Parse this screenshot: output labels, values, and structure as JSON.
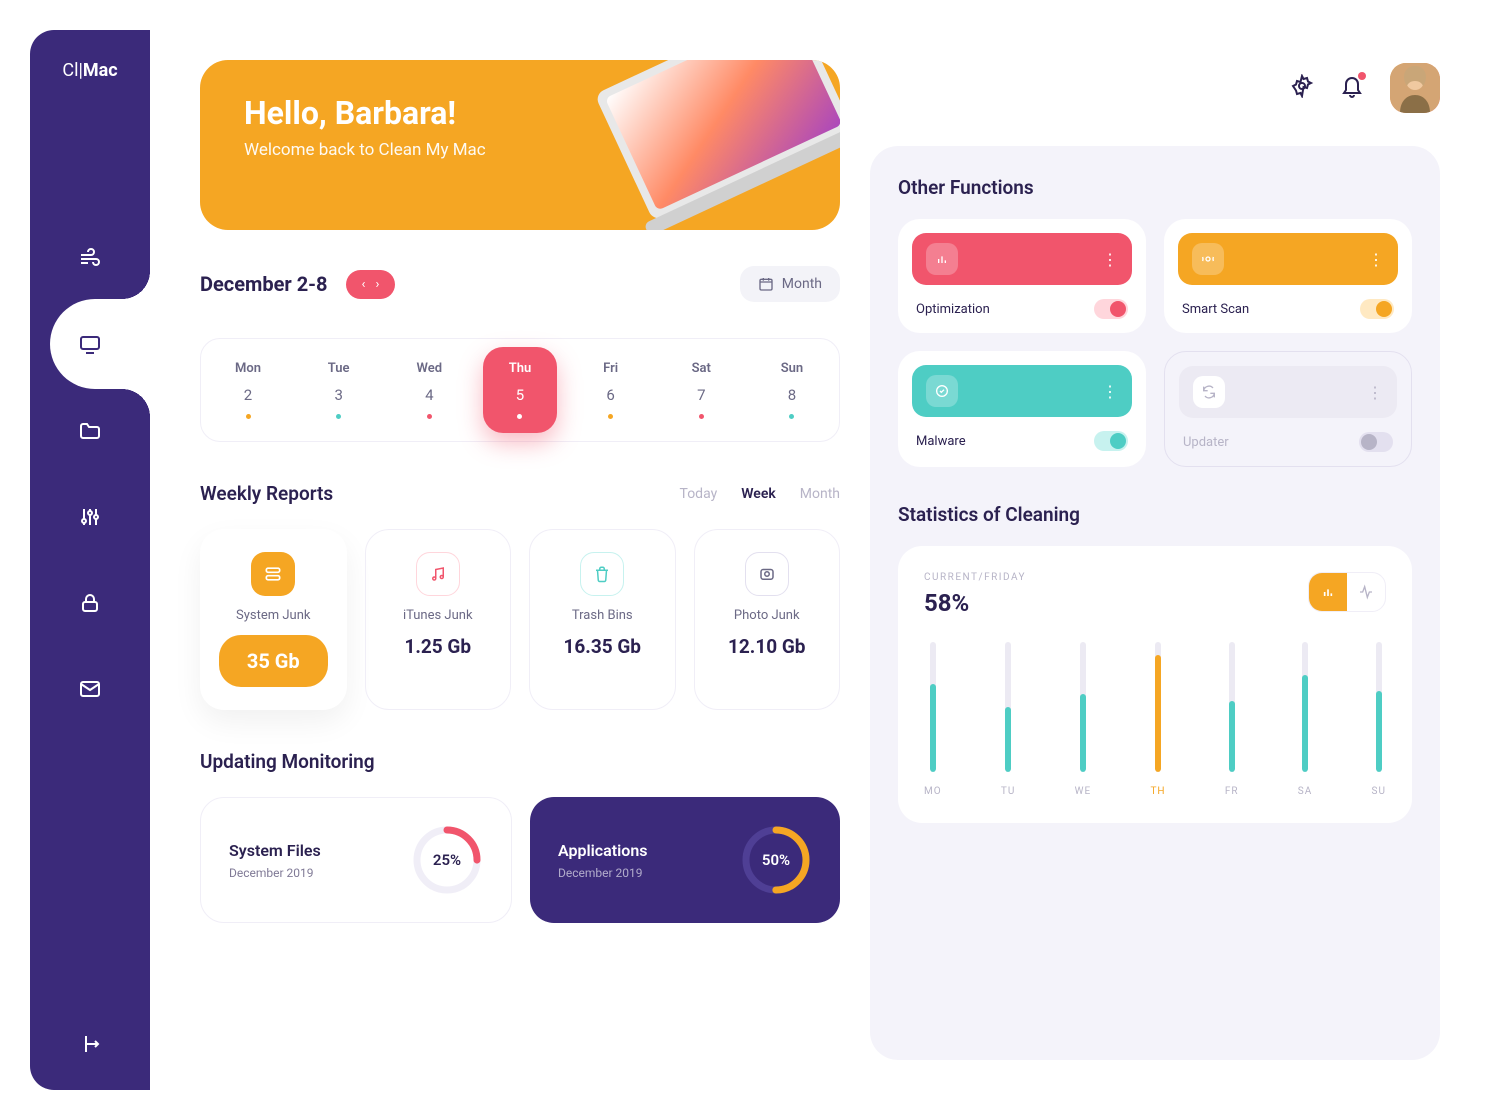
{
  "brand": {
    "prefix": "Cl",
    "name": "Mac"
  },
  "hero": {
    "greeting": "Hello, Barbara!",
    "subtitle": "Welcome back to Clean My Mac"
  },
  "date": {
    "range": "December 2-8",
    "view_label": "Month"
  },
  "days": [
    {
      "name": "Mon",
      "num": "2",
      "dot": "#f5a623"
    },
    {
      "name": "Tue",
      "num": "3",
      "dot": "#4ecdc4"
    },
    {
      "name": "Wed",
      "num": "4",
      "dot": "#f1556c"
    },
    {
      "name": "Thu",
      "num": "5",
      "dot": "#ffffff",
      "active": true
    },
    {
      "name": "Fri",
      "num": "6",
      "dot": "#f5a623"
    },
    {
      "name": "Sat",
      "num": "7",
      "dot": "#f1556c"
    },
    {
      "name": "Sun",
      "num": "8",
      "dot": "#4ecdc4"
    }
  ],
  "reports": {
    "title": "Weekly Reports",
    "tabs": {
      "today": "Today",
      "week": "Week",
      "month": "Month"
    },
    "cards": [
      {
        "name": "System Junk",
        "value": "35 Gb",
        "active": true
      },
      {
        "name": "iTunes Junk",
        "value": "1.25 Gb"
      },
      {
        "name": "Trash Bins",
        "value": "16.35 Gb"
      },
      {
        "name": "Photo Junk",
        "value": "12.10 Gb"
      }
    ]
  },
  "monitoring": {
    "title": "Updating Monitoring",
    "items": [
      {
        "title": "System Files",
        "sub": "December 2019",
        "pct": "25%",
        "pct_num": 25,
        "color": "#f1556c"
      },
      {
        "title": "Applications",
        "sub": "December 2019",
        "pct": "50%",
        "pct_num": 50,
        "color": "#f5a623",
        "dark": true
      }
    ]
  },
  "functions": {
    "title": "Other Functions",
    "items": [
      {
        "label": "Optimization",
        "color": "red"
      },
      {
        "label": "Smart Scan",
        "color": "orange"
      },
      {
        "label": "Malware",
        "color": "cyan"
      },
      {
        "label": "Updater",
        "color": "gray",
        "disabled": true
      }
    ]
  },
  "stats": {
    "title": "Statistics of Cleaning",
    "label": "CURRENT/FRIDAY",
    "pct": "58%"
  },
  "chart_data": {
    "type": "bar",
    "categories": [
      "MO",
      "TU",
      "WE",
      "TH",
      "FR",
      "SA",
      "SU"
    ],
    "values": [
      68,
      50,
      60,
      90,
      55,
      75,
      62
    ],
    "highlight_index": 3,
    "ylim": [
      0,
      100
    ],
    "colors": {
      "default": "#4ecdc4",
      "highlight": "#f5a623"
    }
  }
}
